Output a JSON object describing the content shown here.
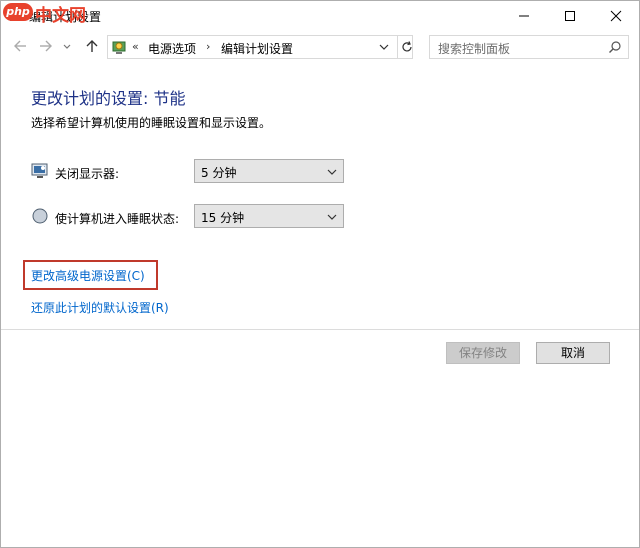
{
  "window": {
    "title": "编辑计划设置",
    "watermark_badge": "php",
    "watermark_text": "中文网"
  },
  "address": {
    "chevron": "«",
    "crumbs": [
      "电源选项",
      "编辑计划设置"
    ],
    "search_placeholder": "搜索控制面板"
  },
  "main": {
    "heading": "更改计划的设置: 节能",
    "subtext": "选择希望计算机使用的睡眠设置和显示设置。",
    "display_label": "关闭显示器:",
    "display_value": "5 分钟",
    "sleep_label": "使计算机进入睡眠状态:",
    "sleep_value": "15 分钟",
    "advanced_link": "更改高级电源设置(C)",
    "restore_link": "还原此计划的默认设置(R)"
  },
  "buttons": {
    "save": "保存修改",
    "cancel": "取消"
  },
  "colors": {
    "heading": "#1e3287",
    "link": "#0066cc",
    "highlight_border": "#c0392b"
  }
}
